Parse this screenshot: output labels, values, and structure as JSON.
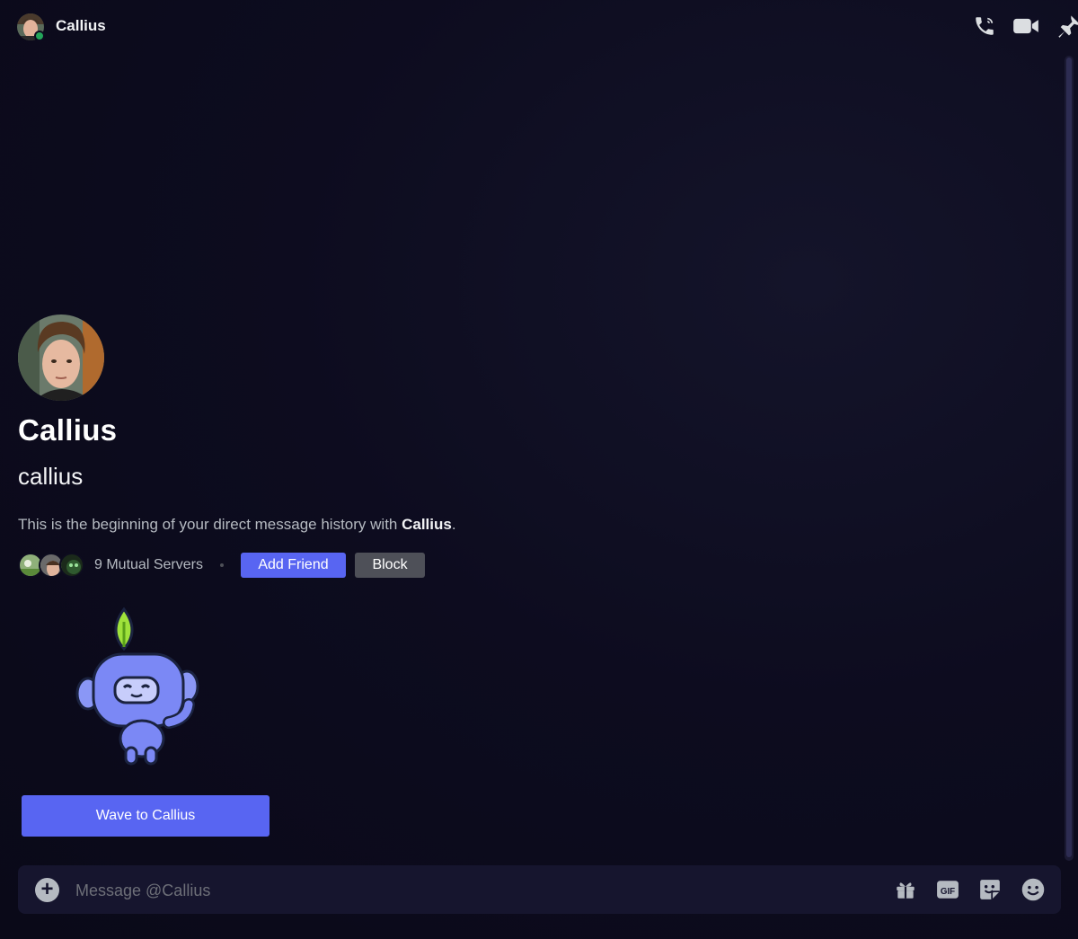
{
  "header": {
    "title": "Callius",
    "status": "online",
    "status_color": "#23a55a",
    "actions": [
      "phone-call-icon",
      "video-camera-icon",
      "pin-icon"
    ]
  },
  "profile": {
    "display_name": "Callius",
    "username": "callius",
    "intro_prefix": "This is the beginning of your direct message history with ",
    "intro_name": "Callius",
    "intro_suffix": "."
  },
  "mutual": {
    "label": "9 Mutual Servers",
    "add_friend_label": "Add Friend",
    "block_label": "Block"
  },
  "wave": {
    "button_label": "Wave to Callius",
    "sticker": "wumpus-waving-sticker"
  },
  "composer": {
    "placeholder": "Message @Callius",
    "value": "",
    "icons": [
      "add-attachment-icon",
      "gift-icon",
      "gif-icon",
      "sticker-icon",
      "emoji-icon"
    ]
  },
  "colors": {
    "brand": "#5865f2",
    "secondary_button": "#4e5058",
    "background": "#0d0c1f",
    "online": "#23a55a"
  }
}
